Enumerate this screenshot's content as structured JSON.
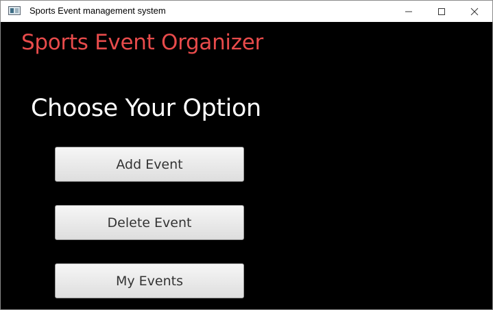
{
  "window": {
    "title": "Sports Event management system"
  },
  "header": {
    "app_title": "Sports Event Organizer",
    "prompt": "Choose Your Option"
  },
  "actions": [
    {
      "label": "Add Event"
    },
    {
      "label": "Delete Event"
    },
    {
      "label": "My Events"
    }
  ],
  "colors": {
    "background": "#000000",
    "app_title": "#e84b4b",
    "prompt": "#ffffff",
    "button_text": "#333333"
  },
  "icons": {
    "app": "app-window-icon",
    "minimize": "minimize-icon",
    "maximize": "maximize-icon",
    "close": "close-icon"
  }
}
